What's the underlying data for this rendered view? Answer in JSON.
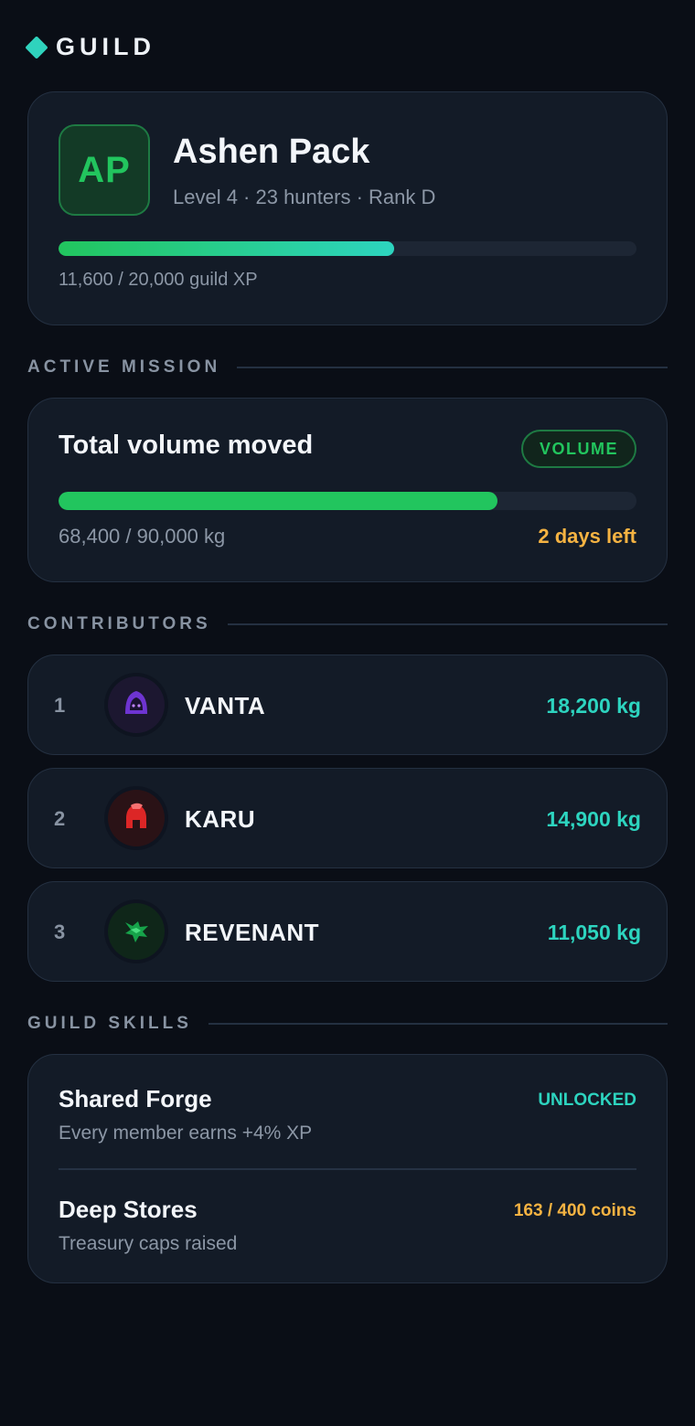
{
  "header": {
    "title": "GUILD",
    "accent": "#2fd3bd"
  },
  "guild": {
    "initials": "AP",
    "name": "Ashen Pack",
    "meta": "Level 4 · 23 hunters · Rank D",
    "xp_current": 11600,
    "xp_max": 20000,
    "xp_fraction": 0.58,
    "xp_text": "11,600 / 20,000 guild XP"
  },
  "sections": {
    "mission": "ACTIVE MISSION",
    "contributors": "CONTRIBUTORS",
    "skills": "GUILD SKILLS"
  },
  "mission": {
    "title": "Total volume moved",
    "badge": "VOLUME",
    "current": 68400,
    "target": 90000,
    "fraction": 0.76,
    "progress_text": "68,400 / 90,000 kg",
    "time_left": "2 days left"
  },
  "contributors": [
    {
      "rank": "1",
      "name": "VANTA",
      "value": "18,200 kg",
      "icon": "hooded-figure-icon",
      "color": "#a855f7"
    },
    {
      "rank": "2",
      "name": "KARU",
      "value": "14,900 kg",
      "icon": "spartan-helmet-icon",
      "color": "#ef4444"
    },
    {
      "rank": "3",
      "name": "REVENANT",
      "value": "11,050 kg",
      "icon": "wolf-head-icon",
      "color": "#22c55e"
    }
  ],
  "skills": [
    {
      "name": "Shared Forge",
      "desc": "Every member earns +4% XP",
      "status": "UNLOCKED",
      "status_color": "#2dd4bf"
    },
    {
      "name": "Deep Stores",
      "desc": "Treasury caps raised",
      "status": "163 / 400 coins",
      "status_color": "#f5b342"
    }
  ]
}
